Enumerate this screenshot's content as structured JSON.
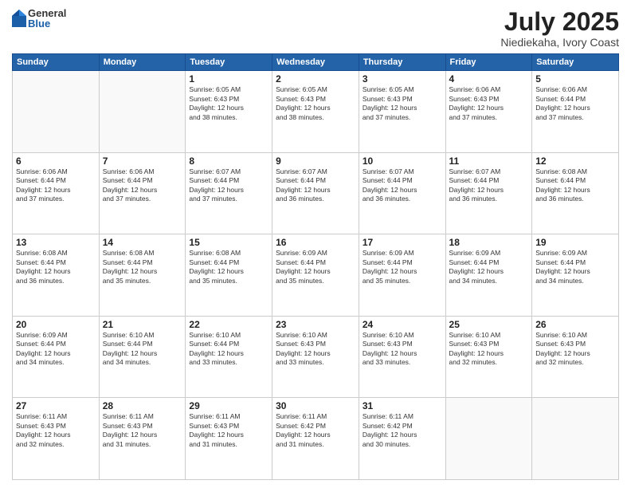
{
  "logo": {
    "general": "General",
    "blue": "Blue"
  },
  "title": {
    "month": "July 2025",
    "location": "Niediekaha, Ivory Coast"
  },
  "headers": [
    "Sunday",
    "Monday",
    "Tuesday",
    "Wednesday",
    "Thursday",
    "Friday",
    "Saturday"
  ],
  "weeks": [
    [
      {
        "day": "",
        "info": ""
      },
      {
        "day": "",
        "info": ""
      },
      {
        "day": "1",
        "info": "Sunrise: 6:05 AM\nSunset: 6:43 PM\nDaylight: 12 hours\nand 38 minutes."
      },
      {
        "day": "2",
        "info": "Sunrise: 6:05 AM\nSunset: 6:43 PM\nDaylight: 12 hours\nand 38 minutes."
      },
      {
        "day": "3",
        "info": "Sunrise: 6:05 AM\nSunset: 6:43 PM\nDaylight: 12 hours\nand 37 minutes."
      },
      {
        "day": "4",
        "info": "Sunrise: 6:06 AM\nSunset: 6:43 PM\nDaylight: 12 hours\nand 37 minutes."
      },
      {
        "day": "5",
        "info": "Sunrise: 6:06 AM\nSunset: 6:44 PM\nDaylight: 12 hours\nand 37 minutes."
      }
    ],
    [
      {
        "day": "6",
        "info": "Sunrise: 6:06 AM\nSunset: 6:44 PM\nDaylight: 12 hours\nand 37 minutes."
      },
      {
        "day": "7",
        "info": "Sunrise: 6:06 AM\nSunset: 6:44 PM\nDaylight: 12 hours\nand 37 minutes."
      },
      {
        "day": "8",
        "info": "Sunrise: 6:07 AM\nSunset: 6:44 PM\nDaylight: 12 hours\nand 37 minutes."
      },
      {
        "day": "9",
        "info": "Sunrise: 6:07 AM\nSunset: 6:44 PM\nDaylight: 12 hours\nand 36 minutes."
      },
      {
        "day": "10",
        "info": "Sunrise: 6:07 AM\nSunset: 6:44 PM\nDaylight: 12 hours\nand 36 minutes."
      },
      {
        "day": "11",
        "info": "Sunrise: 6:07 AM\nSunset: 6:44 PM\nDaylight: 12 hours\nand 36 minutes."
      },
      {
        "day": "12",
        "info": "Sunrise: 6:08 AM\nSunset: 6:44 PM\nDaylight: 12 hours\nand 36 minutes."
      }
    ],
    [
      {
        "day": "13",
        "info": "Sunrise: 6:08 AM\nSunset: 6:44 PM\nDaylight: 12 hours\nand 36 minutes."
      },
      {
        "day": "14",
        "info": "Sunrise: 6:08 AM\nSunset: 6:44 PM\nDaylight: 12 hours\nand 35 minutes."
      },
      {
        "day": "15",
        "info": "Sunrise: 6:08 AM\nSunset: 6:44 PM\nDaylight: 12 hours\nand 35 minutes."
      },
      {
        "day": "16",
        "info": "Sunrise: 6:09 AM\nSunset: 6:44 PM\nDaylight: 12 hours\nand 35 minutes."
      },
      {
        "day": "17",
        "info": "Sunrise: 6:09 AM\nSunset: 6:44 PM\nDaylight: 12 hours\nand 35 minutes."
      },
      {
        "day": "18",
        "info": "Sunrise: 6:09 AM\nSunset: 6:44 PM\nDaylight: 12 hours\nand 34 minutes."
      },
      {
        "day": "19",
        "info": "Sunrise: 6:09 AM\nSunset: 6:44 PM\nDaylight: 12 hours\nand 34 minutes."
      }
    ],
    [
      {
        "day": "20",
        "info": "Sunrise: 6:09 AM\nSunset: 6:44 PM\nDaylight: 12 hours\nand 34 minutes."
      },
      {
        "day": "21",
        "info": "Sunrise: 6:10 AM\nSunset: 6:44 PM\nDaylight: 12 hours\nand 34 minutes."
      },
      {
        "day": "22",
        "info": "Sunrise: 6:10 AM\nSunset: 6:44 PM\nDaylight: 12 hours\nand 33 minutes."
      },
      {
        "day": "23",
        "info": "Sunrise: 6:10 AM\nSunset: 6:43 PM\nDaylight: 12 hours\nand 33 minutes."
      },
      {
        "day": "24",
        "info": "Sunrise: 6:10 AM\nSunset: 6:43 PM\nDaylight: 12 hours\nand 33 minutes."
      },
      {
        "day": "25",
        "info": "Sunrise: 6:10 AM\nSunset: 6:43 PM\nDaylight: 12 hours\nand 32 minutes."
      },
      {
        "day": "26",
        "info": "Sunrise: 6:10 AM\nSunset: 6:43 PM\nDaylight: 12 hours\nand 32 minutes."
      }
    ],
    [
      {
        "day": "27",
        "info": "Sunrise: 6:11 AM\nSunset: 6:43 PM\nDaylight: 12 hours\nand 32 minutes."
      },
      {
        "day": "28",
        "info": "Sunrise: 6:11 AM\nSunset: 6:43 PM\nDaylight: 12 hours\nand 31 minutes."
      },
      {
        "day": "29",
        "info": "Sunrise: 6:11 AM\nSunset: 6:43 PM\nDaylight: 12 hours\nand 31 minutes."
      },
      {
        "day": "30",
        "info": "Sunrise: 6:11 AM\nSunset: 6:42 PM\nDaylight: 12 hours\nand 31 minutes."
      },
      {
        "day": "31",
        "info": "Sunrise: 6:11 AM\nSunset: 6:42 PM\nDaylight: 12 hours\nand 30 minutes."
      },
      {
        "day": "",
        "info": ""
      },
      {
        "day": "",
        "info": ""
      }
    ]
  ]
}
